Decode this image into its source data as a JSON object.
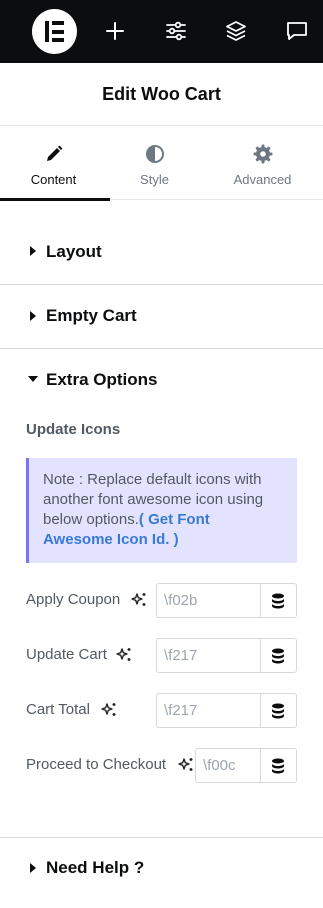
{
  "topbar": {
    "logo": "elementor-logo",
    "icons": [
      "plus-icon",
      "sliders-icon",
      "layers-icon",
      "chat-icon"
    ]
  },
  "header": {
    "title": "Edit Woo Cart"
  },
  "tabs": [
    {
      "label": "Content",
      "icon": "pencil-icon",
      "active": true
    },
    {
      "label": "Style",
      "icon": "contrast-icon",
      "active": false
    },
    {
      "label": "Advanced",
      "icon": "gear-icon",
      "active": false
    }
  ],
  "sections": {
    "layout": {
      "title": "Layout",
      "expanded": false
    },
    "empty_cart": {
      "title": "Empty Cart",
      "expanded": false
    },
    "extra_options": {
      "title": "Extra Options",
      "expanded": true
    },
    "need_help": {
      "title": "Need Help ?",
      "expanded": false
    }
  },
  "extra": {
    "subheading": "Update Icons",
    "note_text": "Note : Replace default icons with another font awesome icon using below options.",
    "note_link": "( Get Font Awesome Icon Id. )",
    "controls": [
      {
        "label": "Apply Coupon",
        "placeholder": "\\f02b"
      },
      {
        "label": "Update Cart",
        "placeholder": "\\f217"
      },
      {
        "label": "Cart Total",
        "placeholder": "\\f217"
      },
      {
        "label": "Proceed to Checkout",
        "placeholder": "\\f00c"
      }
    ]
  },
  "colors": {
    "topbar_bg": "#0c0d0e",
    "note_bg": "#e4e3ff",
    "note_border": "#7a73f3",
    "link": "#3a7ad6"
  }
}
